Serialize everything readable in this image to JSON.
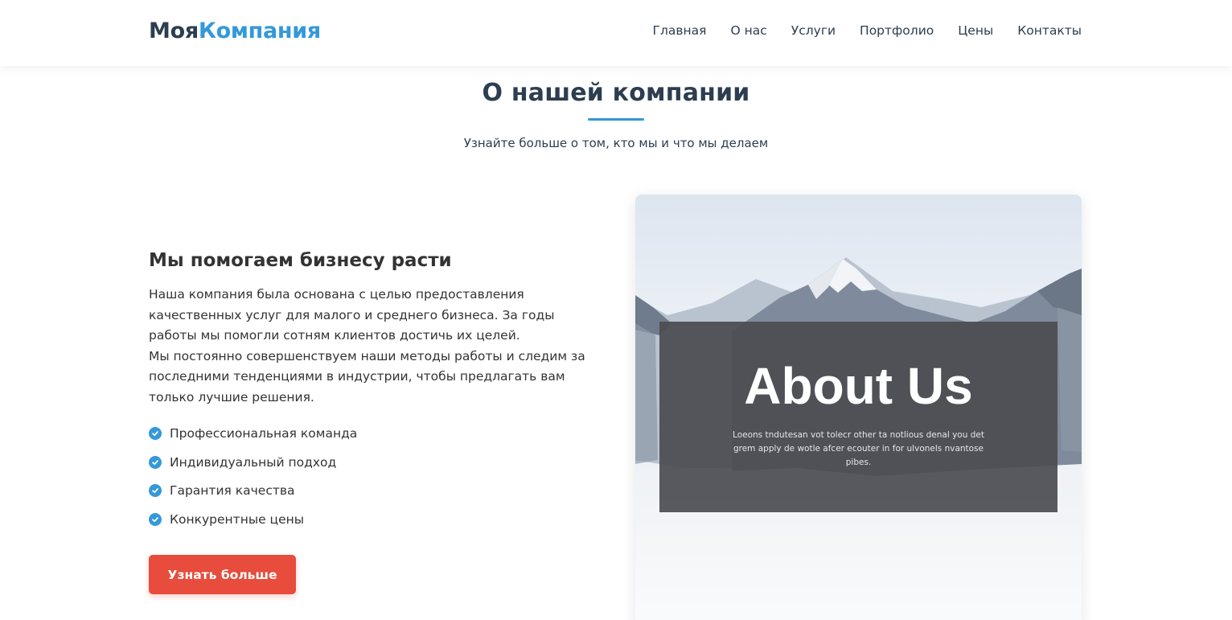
{
  "header": {
    "logo_part1": "Моя",
    "logo_part2": "Компания",
    "nav": [
      "Главная",
      "О нас",
      "Услуги",
      "Портфолио",
      "Цены",
      "Контакты"
    ]
  },
  "section": {
    "title": "О нашей компании",
    "subtitle": "Узнайте больше о том, кто мы и что мы делаем"
  },
  "content": {
    "heading": "Мы помогаем бизнесу расти",
    "paragraph1": "Наша компания была основана с целью предоставления качественных услуг для малого и среднего бизнеса. За годы работы мы помогли сотням клиентов достичь их целей.",
    "paragraph2": "Мы постоянно совершенствуем наши методы работы и следим за последними тенденциями в индустрии, чтобы предлагать вам только лучшие решения.",
    "features": [
      "Профессиональная команда",
      "Индивидуальный подход",
      "Гарантия качества",
      "Конкурентные цены"
    ],
    "button_label": "Узнать больше"
  },
  "image": {
    "title": "About Us",
    "caption": "Loeons tndutesan vot tolecr other ta notlious denal you det grem apply de wotle afcer ecouter in for ulvonels nvantose pibes."
  },
  "colors": {
    "primary": "#3498db",
    "accent": "#e74c3c",
    "text": "#2c3e50"
  }
}
